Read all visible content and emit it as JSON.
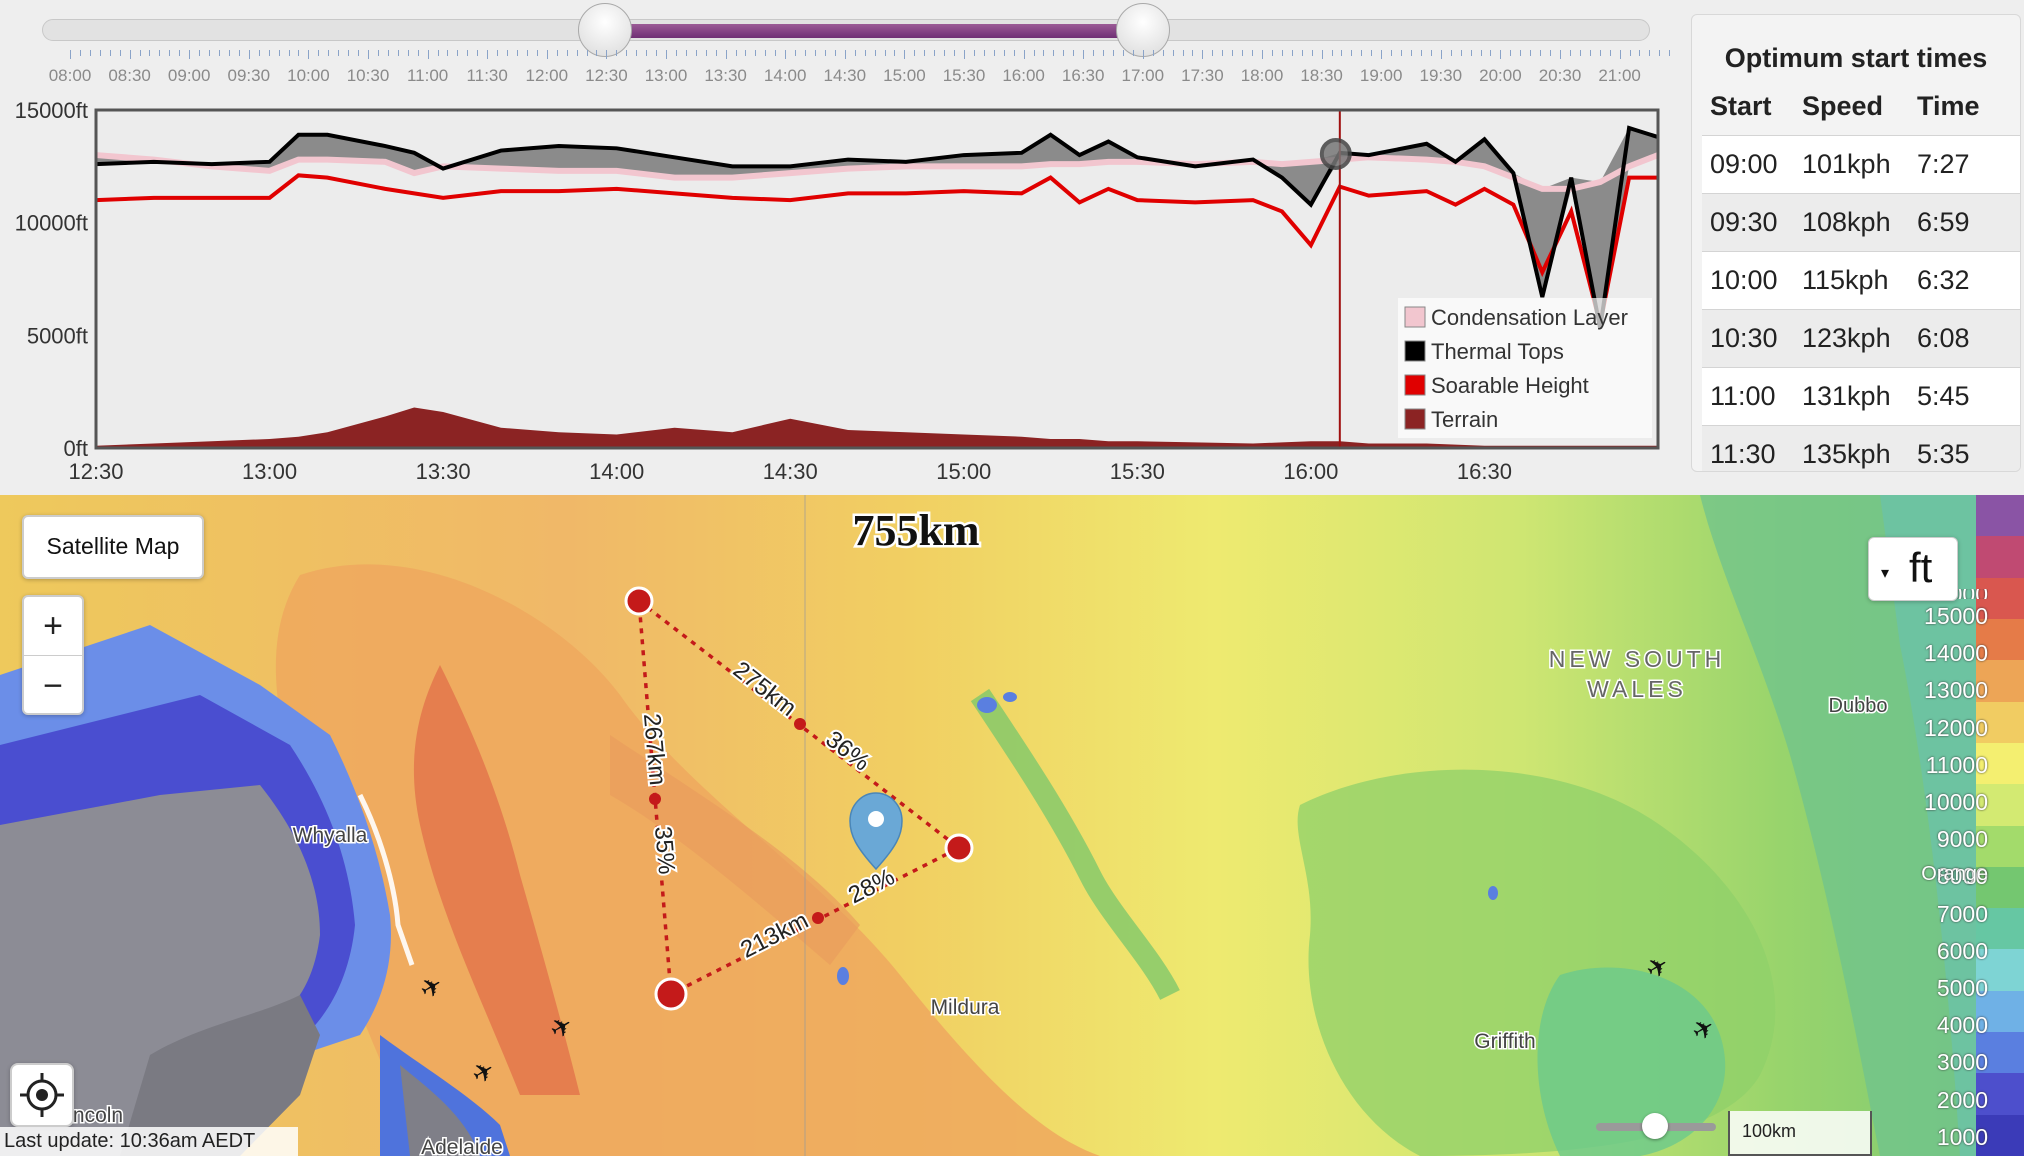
{
  "time_slider": {
    "labels": [
      "08:00",
      "08:30",
      "09:00",
      "09:30",
      "10:00",
      "10:30",
      "11:00",
      "11:30",
      "12:00",
      "12:30",
      "13:00",
      "13:30",
      "14:00",
      "14:30",
      "15:00",
      "15:30",
      "16:00",
      "16:30",
      "17:00",
      "17:30",
      "18:00",
      "18:30",
      "19:00",
      "19:30",
      "20:00",
      "20:30",
      "21:00"
    ],
    "range_start": "12:30",
    "range_end": "17:30"
  },
  "chart_data": {
    "type": "area",
    "y_tick_labels": [
      "15000ft",
      "10000ft",
      "5000ft",
      "0ft"
    ],
    "x_tick_labels": [
      "12:30",
      "13:00",
      "13:30",
      "14:00",
      "14:30",
      "15:00",
      "15:30",
      "16:00",
      "16:30"
    ],
    "ylim": [
      0,
      15000
    ],
    "x_range": [
      "12:30",
      "17:00"
    ],
    "grid": true,
    "legend_position": "bottom-right",
    "cursor_time": "16:05",
    "legend": [
      {
        "name": "Condensation Layer",
        "color": "#f2c6cf"
      },
      {
        "name": "Thermal Tops",
        "color": "#000000"
      },
      {
        "name": "Soarable Height",
        "color": "#e00000"
      },
      {
        "name": "Terrain",
        "color": "#8b2323"
      }
    ],
    "x": [
      "12:30",
      "12:40",
      "12:50",
      "13:00",
      "13:05",
      "13:10",
      "13:20",
      "13:25",
      "13:30",
      "13:40",
      "13:50",
      "14:00",
      "14:10",
      "14:20",
      "14:30",
      "14:40",
      "14:50",
      "15:00",
      "15:10",
      "15:15",
      "15:20",
      "15:25",
      "15:30",
      "15:40",
      "15:50",
      "15:55",
      "16:00",
      "16:05",
      "16:10",
      "16:20",
      "16:25",
      "16:30",
      "16:35",
      "16:40",
      "16:45",
      "16:50",
      "16:55",
      "17:00"
    ],
    "series": [
      {
        "name": "Condensation Layer",
        "values": [
          13000,
          12800,
          12500,
          12300,
          12800,
          12800,
          12700,
          12200,
          12500,
          12400,
          12300,
          12300,
          12000,
          12000,
          12200,
          12400,
          12500,
          12500,
          12500,
          12600,
          12600,
          12700,
          12700,
          12600,
          12700,
          12600,
          12700,
          12800,
          12900,
          12800,
          12700,
          12500,
          12000,
          11500,
          11500,
          11800,
          12500,
          13000
        ]
      },
      {
        "name": "Thermal Tops",
        "values": [
          12600,
          12700,
          12600,
          12700,
          13900,
          13900,
          13400,
          13100,
          12400,
          13200,
          13400,
          13300,
          12900,
          12500,
          12500,
          12800,
          12700,
          13000,
          13100,
          13900,
          13000,
          13600,
          12900,
          12500,
          12800,
          12000,
          10800,
          13100,
          13000,
          13500,
          12700,
          13700,
          12200,
          6700,
          12000,
          5300,
          14200,
          13800
        ]
      },
      {
        "name": "Soarable Height",
        "values": [
          11000,
          11100,
          11100,
          11100,
          12100,
          12000,
          11500,
          11300,
          11100,
          11400,
          11400,
          11500,
          11300,
          11100,
          11000,
          11300,
          11300,
          11400,
          11300,
          12000,
          10900,
          11500,
          11000,
          10900,
          11000,
          10500,
          9000,
          11600,
          11200,
          11400,
          10800,
          11500,
          10800,
          7800,
          10500,
          5500,
          12000,
          12000
        ]
      },
      {
        "name": "Terrain",
        "values": [
          100,
          200,
          300,
          400,
          500,
          700,
          1400,
          1800,
          1600,
          900,
          700,
          600,
          900,
          700,
          1300,
          800,
          700,
          600,
          500,
          400,
          400,
          300,
          300,
          250,
          200,
          250,
          300,
          300,
          200,
          200,
          150,
          100,
          100,
          100,
          100,
          100,
          100,
          100
        ]
      }
    ]
  },
  "optimum": {
    "title": "Optimum start times",
    "headers": [
      "Start",
      "Speed",
      "Time"
    ],
    "rows": [
      {
        "start": "09:00",
        "speed": "101kph",
        "time": "7:27"
      },
      {
        "start": "09:30",
        "speed": "108kph",
        "time": "6:59"
      },
      {
        "start": "10:00",
        "speed": "115kph",
        "time": "6:32"
      },
      {
        "start": "10:30",
        "speed": "123kph",
        "time": "6:08"
      },
      {
        "start": "11:00",
        "speed": "131kph",
        "time": "5:45"
      },
      {
        "start": "11:30",
        "speed": "135kph",
        "time": "5:35"
      }
    ]
  },
  "map": {
    "satellite_button": "Satellite Map",
    "zoom_in": "+",
    "zoom_out": "−",
    "total_distance": "755km",
    "units_button": "ft",
    "last_update": "Last update: 10:36am AEDT",
    "scale_label": "100km",
    "places": [
      "Whyalla",
      "Mildura",
      "Griffith",
      "Dubbo",
      "NEW SOUTH",
      "WALES",
      "Adelaide",
      "t Lincoln"
    ],
    "legs": [
      {
        "distance": "275km",
        "percent": "36%"
      },
      {
        "distance": "267km",
        "percent": "35%"
      },
      {
        "distance": "213km",
        "percent": "28%"
      }
    ],
    "color_scale": {
      "labels": [
        "15000",
        "14000",
        "13000",
        "12000",
        "11000",
        "10000",
        "9000",
        "8000",
        "7000",
        "6000",
        "5000",
        "4000",
        "3000",
        "2000",
        "1000"
      ],
      "cropped_top_label": "16000",
      "overlay_label": "Orange",
      "colors": [
        "#8a54a5",
        "#c04a72",
        "#d9574f",
        "#e57b48",
        "#eda556",
        "#f1cc62",
        "#f4ef70",
        "#d3ea72",
        "#a3db6b",
        "#74c770",
        "#66c7a3",
        "#7ed4d4",
        "#6fb1e6",
        "#5a7fe0",
        "#4d4fcc",
        "#3b3bb8"
      ]
    }
  }
}
